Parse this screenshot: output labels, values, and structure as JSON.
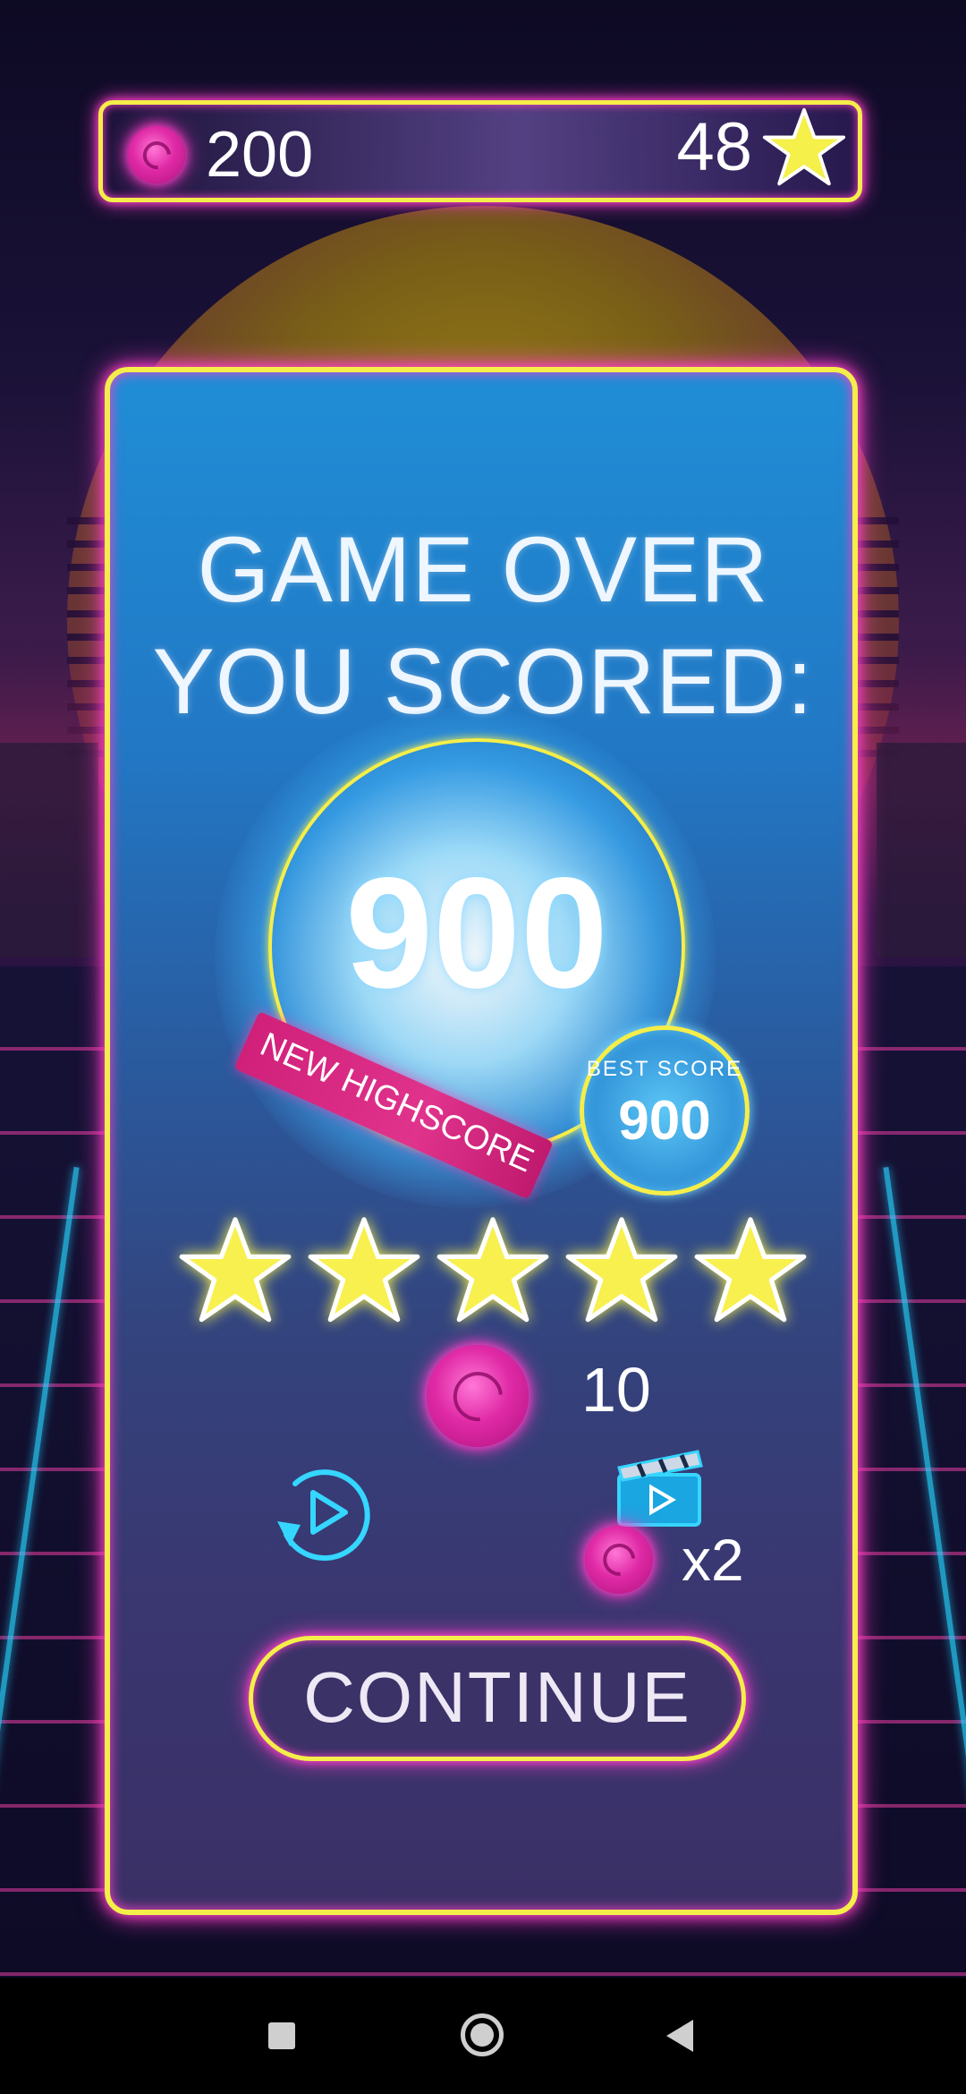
{
  "topbar": {
    "coins": "200",
    "stars": "48"
  },
  "panel": {
    "title_line1": "GAME OVER",
    "title_line2": "YOU SCORED:",
    "score": "900",
    "ribbon": "NEW HIGHSCORE",
    "best_label": "BEST SCORE",
    "best_score": "900",
    "stars_earned": 5,
    "stars_total": 5,
    "coin_reward": "10",
    "ad_multiplier": "x2",
    "continue_label": "CONTINUE"
  },
  "colors": {
    "neon_yellow": "#f5ee4a",
    "neon_pink": "#ff3fc8",
    "neon_cyan": "#28d3ff",
    "coin_pink": "#e02aa6",
    "panel_blue": "#1f8ed6"
  },
  "icons": {
    "coin": "pink-coin-icon",
    "star": "star-icon",
    "replay": "replay-icon",
    "ad": "clapperboard-icon"
  }
}
